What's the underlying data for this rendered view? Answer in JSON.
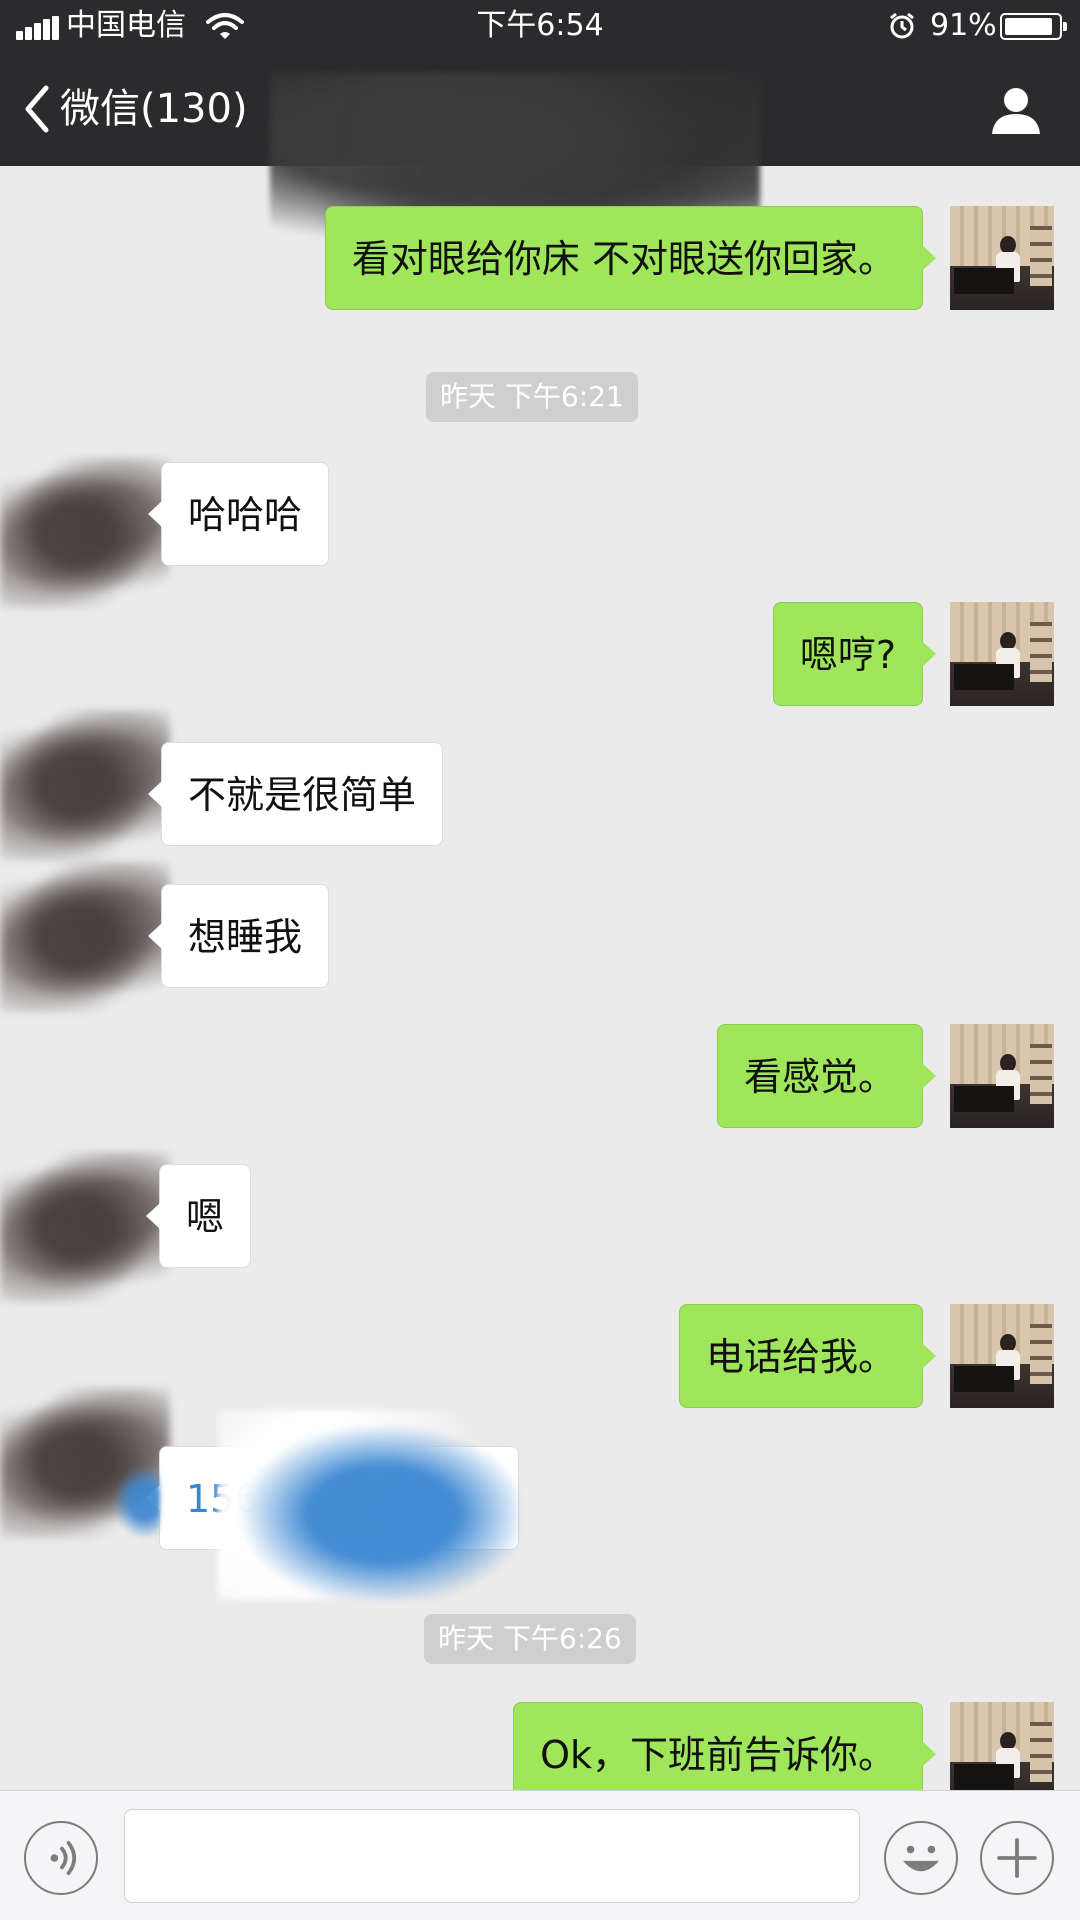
{
  "status_bar": {
    "carrier": "中国电信",
    "time": "下午6:54",
    "battery": "91%",
    "battery_level": 0.91,
    "icons": [
      "signal-icon",
      "wifi-icon",
      "alarm-icon",
      "battery-icon"
    ]
  },
  "nav": {
    "back_label": "微信(130)",
    "icons": [
      "chevron-left-icon",
      "profile-icon"
    ]
  },
  "messages": [
    {
      "sender": "me",
      "text": "看对眼给你床 不对眼送你回家。"
    },
    {
      "type": "time",
      "text": "昨天 下午6:21"
    },
    {
      "sender": "them",
      "text": "哈哈哈"
    },
    {
      "sender": "me",
      "text": "嗯哼?"
    },
    {
      "sender": "them",
      "text": "不就是很简单"
    },
    {
      "sender": "them",
      "text": "想睡我"
    },
    {
      "sender": "me",
      "text": "看感觉。"
    },
    {
      "sender": "them",
      "text": "嗯"
    },
    {
      "sender": "me",
      "text": "电话给我。"
    },
    {
      "sender": "them",
      "text": "156"
    },
    {
      "type": "time",
      "text": "昨天 下午6:26"
    },
    {
      "sender": "me",
      "text": "Ok，下班前告诉你。"
    }
  ],
  "input_bar": {
    "value": "",
    "icons": [
      "voice-icon",
      "emoji-icon",
      "plus-icon"
    ]
  },
  "colors": {
    "header_bg": "#2b2b2e",
    "chat_bg": "#ebebeb",
    "my_bubble": "#9fe65a",
    "their_bubble": "#ffffff",
    "time_label_bg": "#cfcfcf",
    "phone_link": "#3a86c8"
  }
}
